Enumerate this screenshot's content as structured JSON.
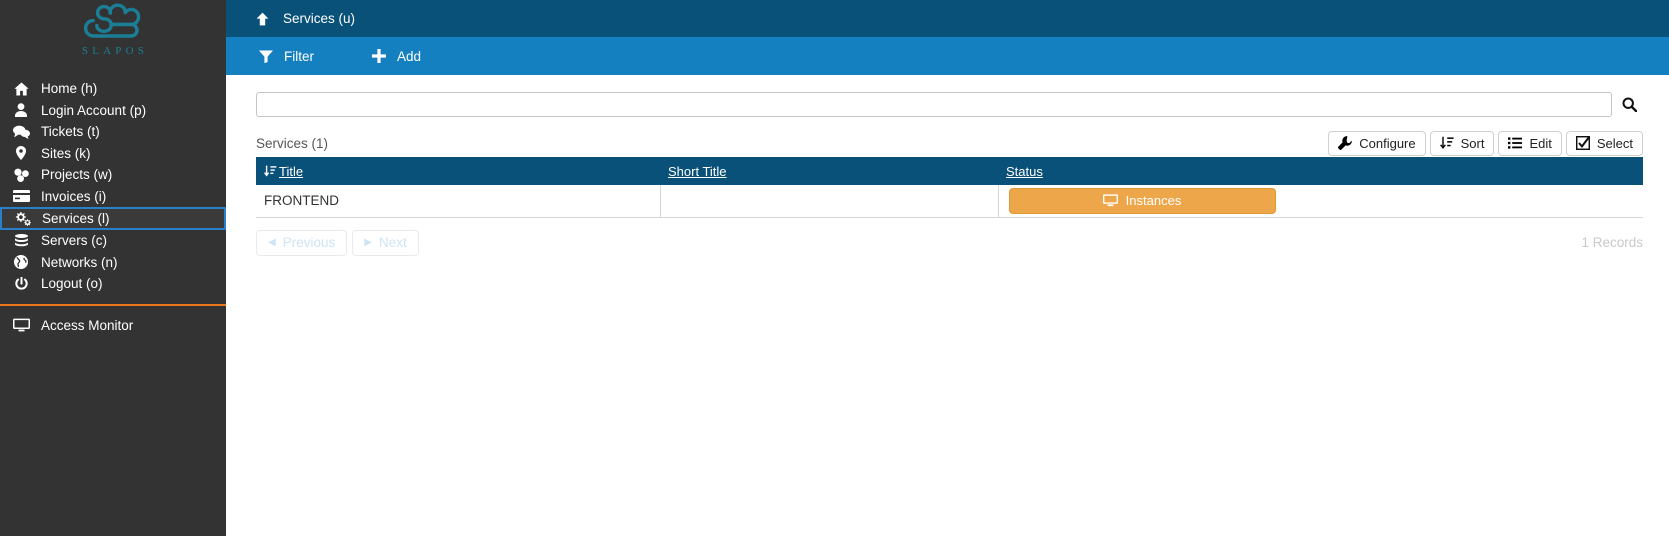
{
  "sidebar": {
    "logo_text": "SLAPOS",
    "logo_icon": "slapos-cloud-logo",
    "items": [
      {
        "label": "Home (h)",
        "icon": "home-icon",
        "selected": false
      },
      {
        "label": "Login Account (p)",
        "icon": "user-icon",
        "selected": false
      },
      {
        "label": "Tickets (t)",
        "icon": "comments-icon",
        "selected": false
      },
      {
        "label": "Sites (k)",
        "icon": "map-marker-icon",
        "selected": false
      },
      {
        "label": "Projects (w)",
        "icon": "cubes-icon",
        "selected": false
      },
      {
        "label": "Invoices (i)",
        "icon": "credit-card-icon",
        "selected": false
      },
      {
        "label": "Services (l)",
        "icon": "cogs-icon",
        "selected": true
      },
      {
        "label": "Servers (c)",
        "icon": "database-icon",
        "selected": false
      },
      {
        "label": "Networks (n)",
        "icon": "globe-icon",
        "selected": false
      },
      {
        "label": "Logout (o)",
        "icon": "power-off-icon",
        "selected": false
      }
    ],
    "bottom_items": [
      {
        "label": "Access Monitor",
        "icon": "desktop-icon"
      }
    ]
  },
  "header": {
    "title": "Services (u)",
    "up_icon": "arrow-up-icon"
  },
  "toolbar": {
    "filter_label": "Filter",
    "filter_icon": "filter-icon",
    "add_label": "Add",
    "add_icon": "plus-icon"
  },
  "search": {
    "value": "",
    "placeholder": "",
    "icon": "search-icon"
  },
  "listbox": {
    "caption": "Services (1)",
    "actions": [
      {
        "label": "Configure",
        "icon": "wrench-icon"
      },
      {
        "label": "Sort",
        "icon": "sort-icon"
      },
      {
        "label": "Edit",
        "icon": "list-icon"
      },
      {
        "label": "Select",
        "icon": "checkbox-icon"
      }
    ],
    "columns": [
      {
        "label": "Title",
        "sorted": true,
        "sort_icon": "sort-amount-asc-icon"
      },
      {
        "label": "Short Title",
        "sorted": false
      },
      {
        "label": "Status",
        "sorted": false
      }
    ],
    "rows": [
      {
        "title": "FRONTEND",
        "short_title": "",
        "status_label": "Instances",
        "status_icon": "desktop-icon"
      }
    ],
    "pagination": {
      "previous_label": "Previous",
      "previous_icon": "caret-left-icon",
      "next_label": "Next",
      "next_icon": "caret-right-icon"
    },
    "records_label": "1 Records"
  },
  "colors": {
    "sidebar_bg": "#333333",
    "header_bg": "#0a5179",
    "toolbar_bg": "#1580c0",
    "accent_orange": "#e8761a",
    "status_orange": "#eda74a",
    "logo_teal": "#1a7f96",
    "selected_border": "#2a7fc9"
  }
}
